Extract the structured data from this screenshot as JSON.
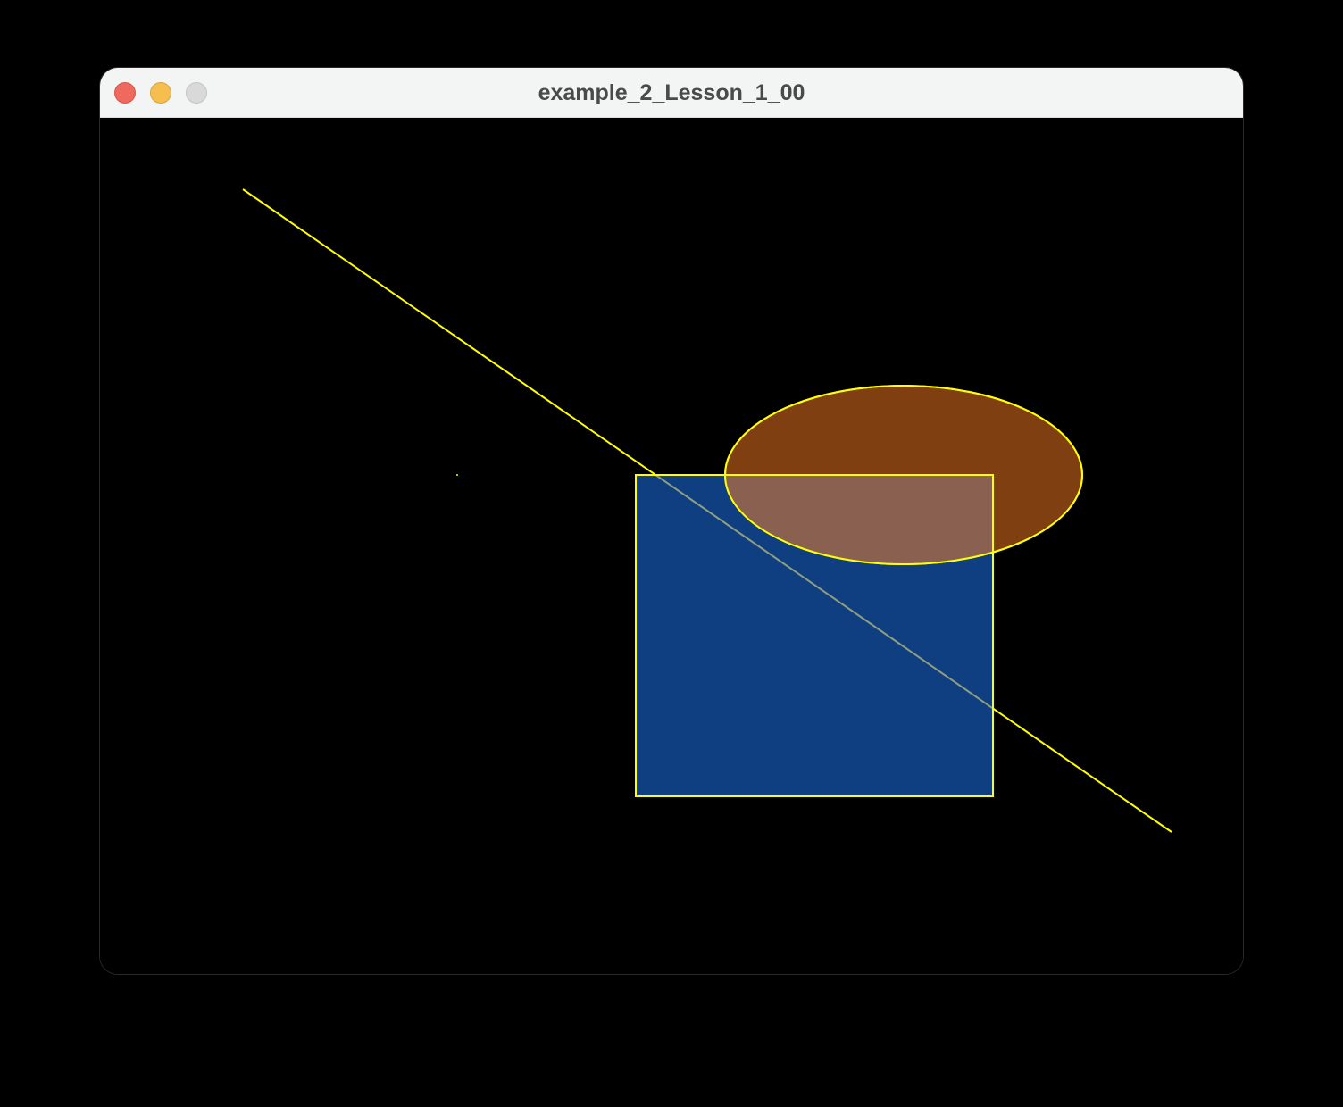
{
  "window": {
    "title": "example_2_Lesson_1_00",
    "controls": {
      "close_color": "#ee6a5f",
      "minimize_color": "#f5be4f",
      "zoom_color": "#d9d9d9"
    }
  },
  "sketch": {
    "background_color": "#000000",
    "stroke_color": "#ffff00",
    "rectangle_fill": "#0f3f80",
    "ellipse_fill": "#7f3f10",
    "overlap_fill": "#8a6050",
    "line_color_in_rectangle": "#8fa080"
  }
}
